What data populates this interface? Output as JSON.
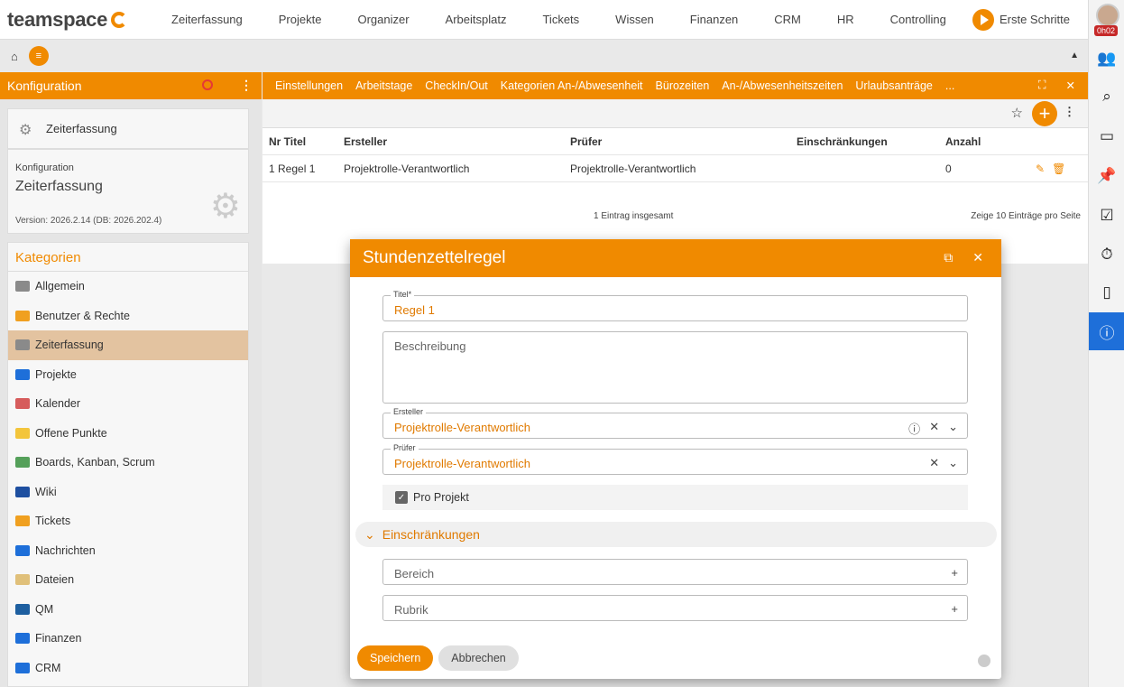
{
  "app": {
    "logo_text": "teamspace"
  },
  "nav": [
    "Zeiterfassung",
    "Projekte",
    "Organizer",
    "Arbeitsplatz",
    "Tickets",
    "Wissen",
    "Finanzen",
    "CRM",
    "HR",
    "Controlling"
  ],
  "erste_schritte": "Erste Schritte",
  "user": {
    "timer": "0h02"
  },
  "sidebar": {
    "title": "Konfiguration",
    "module": "Zeiterfassung",
    "config_label": "Konfiguration",
    "config_title": "Zeiterfassung",
    "version": "Version: 2026.2.14 (DB: 2026.202.4)",
    "categories_title": "Kategorien",
    "items": [
      {
        "label": "Allgemein",
        "color": "#8a8a8a"
      },
      {
        "label": "Benutzer & Rechte",
        "color": "#f0a020"
      },
      {
        "label": "Zeiterfassung",
        "color": "#8a8a8a"
      },
      {
        "label": "Projekte",
        "color": "#1e6fd9"
      },
      {
        "label": "Kalender",
        "color": "#d65c5c"
      },
      {
        "label": "Offene Punkte",
        "color": "#f3c53b"
      },
      {
        "label": "Boards, Kanban, Scrum",
        "color": "#55a05a"
      },
      {
        "label": "Wiki",
        "color": "#1e4fa0"
      },
      {
        "label": "Tickets",
        "color": "#f0a020"
      },
      {
        "label": "Nachrichten",
        "color": "#1e6fd9"
      },
      {
        "label": "Dateien",
        "color": "#e0c07a"
      },
      {
        "label": "QM",
        "color": "#1e5fa0"
      },
      {
        "label": "Finanzen",
        "color": "#1e6fd9"
      },
      {
        "label": "CRM",
        "color": "#1e6fd9"
      }
    ]
  },
  "tabs": [
    "Einstellungen",
    "Arbeitstage",
    "CheckIn/Out",
    "Kategorien An-/Abwesenheit",
    "Bürozeiten",
    "An-/Abwesenheitszeiten",
    "Urlaubsanträge",
    "..."
  ],
  "table": {
    "headers": [
      "Nr Titel",
      "Ersteller",
      "Prüfer",
      "Einschränkungen",
      "Anzahl"
    ],
    "rows": [
      [
        "1 Regel 1",
        "Projektrolle-Verantwortlich",
        "Projektrolle-Verantwortlich",
        "",
        "0"
      ]
    ],
    "total": "1 Eintrag insgesamt",
    "per_page_prefix": "Zeige",
    "per_page_value": "10",
    "per_page_suffix": "Einträge pro Seite"
  },
  "modal": {
    "title": "Stundenzettelregel",
    "titel_label": "Titel*",
    "titel_value": "Regel 1",
    "beschreibung_placeholder": "Beschreibung",
    "ersteller_label": "Ersteller",
    "ersteller_value": "Projektrolle-Verantwortlich",
    "pruefer_label": "Prüfer",
    "pruefer_value": "Projektrolle-Verantwortlich",
    "pro_projekt_label": "Pro Projekt",
    "pro_projekt_checked": true,
    "section_title": "Einschränkungen",
    "bereich_placeholder": "Bereich",
    "rubrik_placeholder": "Rubrik",
    "save_label": "Speichern",
    "cancel_label": "Abbrechen"
  }
}
